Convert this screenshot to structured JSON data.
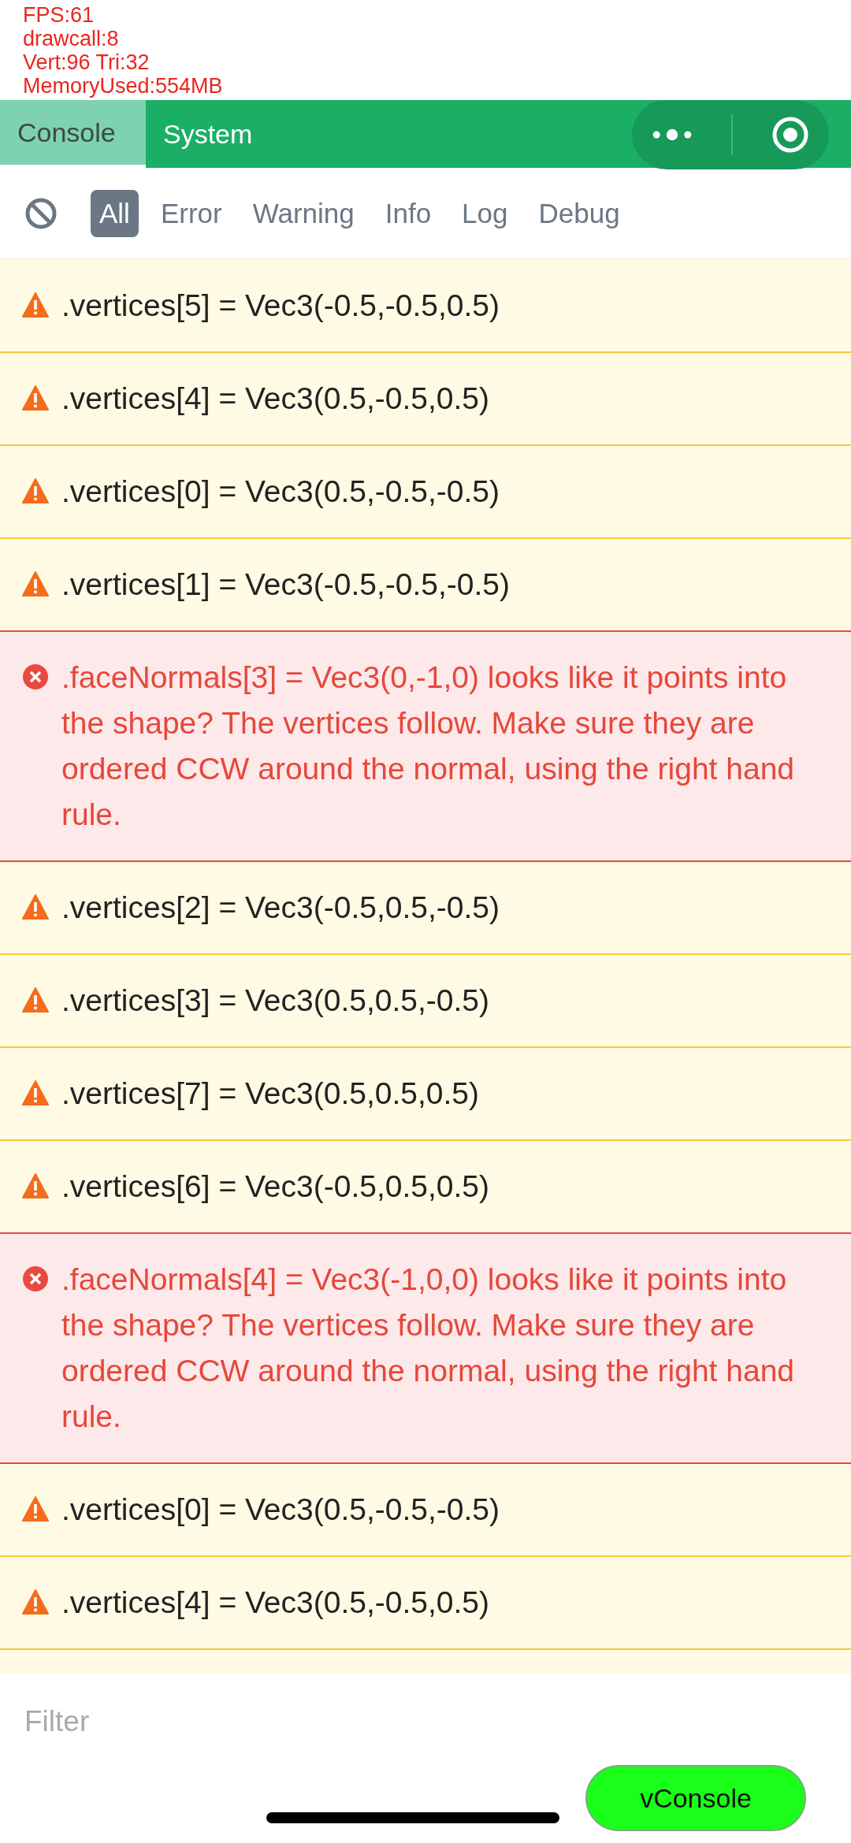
{
  "stats": [
    "FPS:61",
    "drawcall:8",
    "Vert:96 Tri:32",
    "MemoryUsed:554MB"
  ],
  "tabs": [
    {
      "label": "Console",
      "selected": true
    },
    {
      "label": "System",
      "selected": false
    }
  ],
  "filters": [
    {
      "label": "All",
      "selected": true
    },
    {
      "label": "Error",
      "selected": false
    },
    {
      "label": "Warning",
      "selected": false
    },
    {
      "label": "Info",
      "selected": false
    },
    {
      "label": "Log",
      "selected": false
    },
    {
      "label": "Debug",
      "selected": false
    }
  ],
  "logs": [
    {
      "kind": "warning",
      "text": ".vertices[5] = Vec3(-0.5,-0.5,0.5)"
    },
    {
      "kind": "warning",
      "text": ".vertices[4] = Vec3(0.5,-0.5,0.5)"
    },
    {
      "kind": "warning",
      "text": ".vertices[0] = Vec3(0.5,-0.5,-0.5)"
    },
    {
      "kind": "warning",
      "text": ".vertices[1] = Vec3(-0.5,-0.5,-0.5)"
    },
    {
      "kind": "error",
      "text": ".faceNormals[3] = Vec3(0,-1,0) looks like it points into the shape? The vertices follow. Make sure they are ordered CCW around the normal, using the right hand rule."
    },
    {
      "kind": "warning",
      "text": ".vertices[2] = Vec3(-0.5,0.5,-0.5)"
    },
    {
      "kind": "warning",
      "text": ".vertices[3] = Vec3(0.5,0.5,-0.5)"
    },
    {
      "kind": "warning",
      "text": ".vertices[7] = Vec3(0.5,0.5,0.5)"
    },
    {
      "kind": "warning",
      "text": ".vertices[6] = Vec3(-0.5,0.5,0.5)"
    },
    {
      "kind": "error",
      "text": ".faceNormals[4] = Vec3(-1,0,0) looks like it points into the shape? The vertices follow. Make sure they are ordered CCW around the normal, using the right hand rule."
    },
    {
      "kind": "warning",
      "text": ".vertices[0] = Vec3(0.5,-0.5,-0.5)"
    },
    {
      "kind": "warning",
      "text": ".vertices[4] = Vec3(0.5,-0.5,0.5)"
    }
  ],
  "filter_input": {
    "placeholder": "Filter"
  },
  "toggle_button": "vConsole"
}
